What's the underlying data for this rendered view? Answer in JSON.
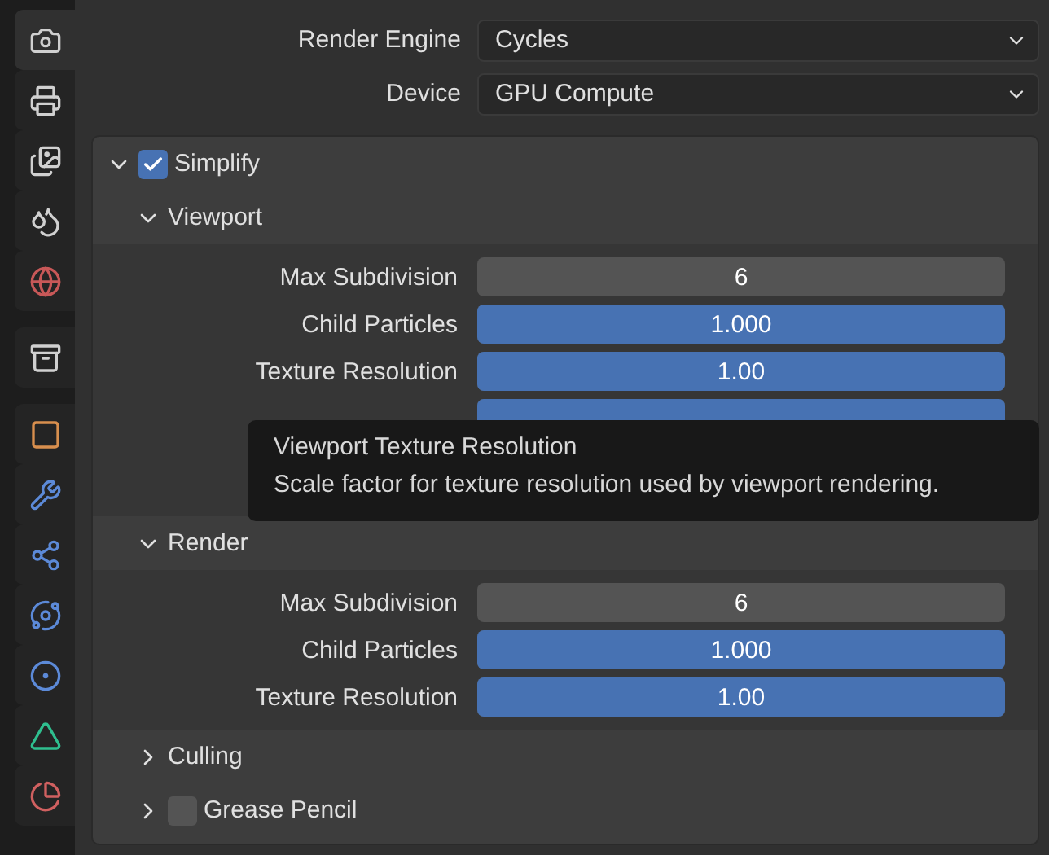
{
  "sidebar": {
    "tabs": [
      {
        "kind": "camera",
        "selected": true
      },
      {
        "kind": "printer",
        "selected": false
      },
      {
        "kind": "images",
        "selected": false
      },
      {
        "kind": "drops",
        "selected": false
      },
      {
        "kind": "globe",
        "selected": false
      },
      {
        "kind": "archive",
        "selected": false
      },
      {
        "kind": "square",
        "selected": false
      },
      {
        "kind": "wrench",
        "selected": false
      },
      {
        "kind": "nodes",
        "selected": false
      },
      {
        "kind": "orbit",
        "selected": false
      },
      {
        "kind": "target",
        "selected": false
      },
      {
        "kind": "triangle",
        "selected": false
      },
      {
        "kind": "pie",
        "selected": false
      }
    ]
  },
  "properties": [
    {
      "label": "Render Engine",
      "value": "Cycles"
    },
    {
      "label": "Device",
      "value": "GPU Compute"
    }
  ],
  "panel": {
    "title": "Simplify",
    "checked": true,
    "expanded": true,
    "subpanels": [
      {
        "title": "Viewport",
        "expanded": true,
        "fields": [
          {
            "label": "Max Subdivision",
            "value": "6",
            "kind": "integer"
          },
          {
            "label": "Child Particles",
            "value": "1.000",
            "kind": "factor",
            "level": 1
          },
          {
            "label": "Texture Resolution",
            "value": "1.00",
            "kind": "factor",
            "level": 1
          },
          {
            "kind": "factor",
            "level": 1
          }
        ]
      },
      {
        "title": "Render",
        "expanded": true,
        "fields": [
          {
            "label": "Max Subdivision",
            "value": "6",
            "kind": "integer"
          },
          {
            "label": "Child Particles",
            "value": "1.000",
            "kind": "factor",
            "level": 1
          },
          {
            "label": "Texture Resolution",
            "value": "1.00",
            "kind": "factor",
            "level": 1
          }
        ]
      },
      {
        "title": "Culling",
        "expanded": false
      },
      {
        "title": "Grease Pencil",
        "expanded": false,
        "checked": false
      }
    ]
  },
  "tooltip": {
    "title": "Viewport Texture Resolution",
    "description": "Scale factor for texture resolution used by viewport rendering."
  }
}
